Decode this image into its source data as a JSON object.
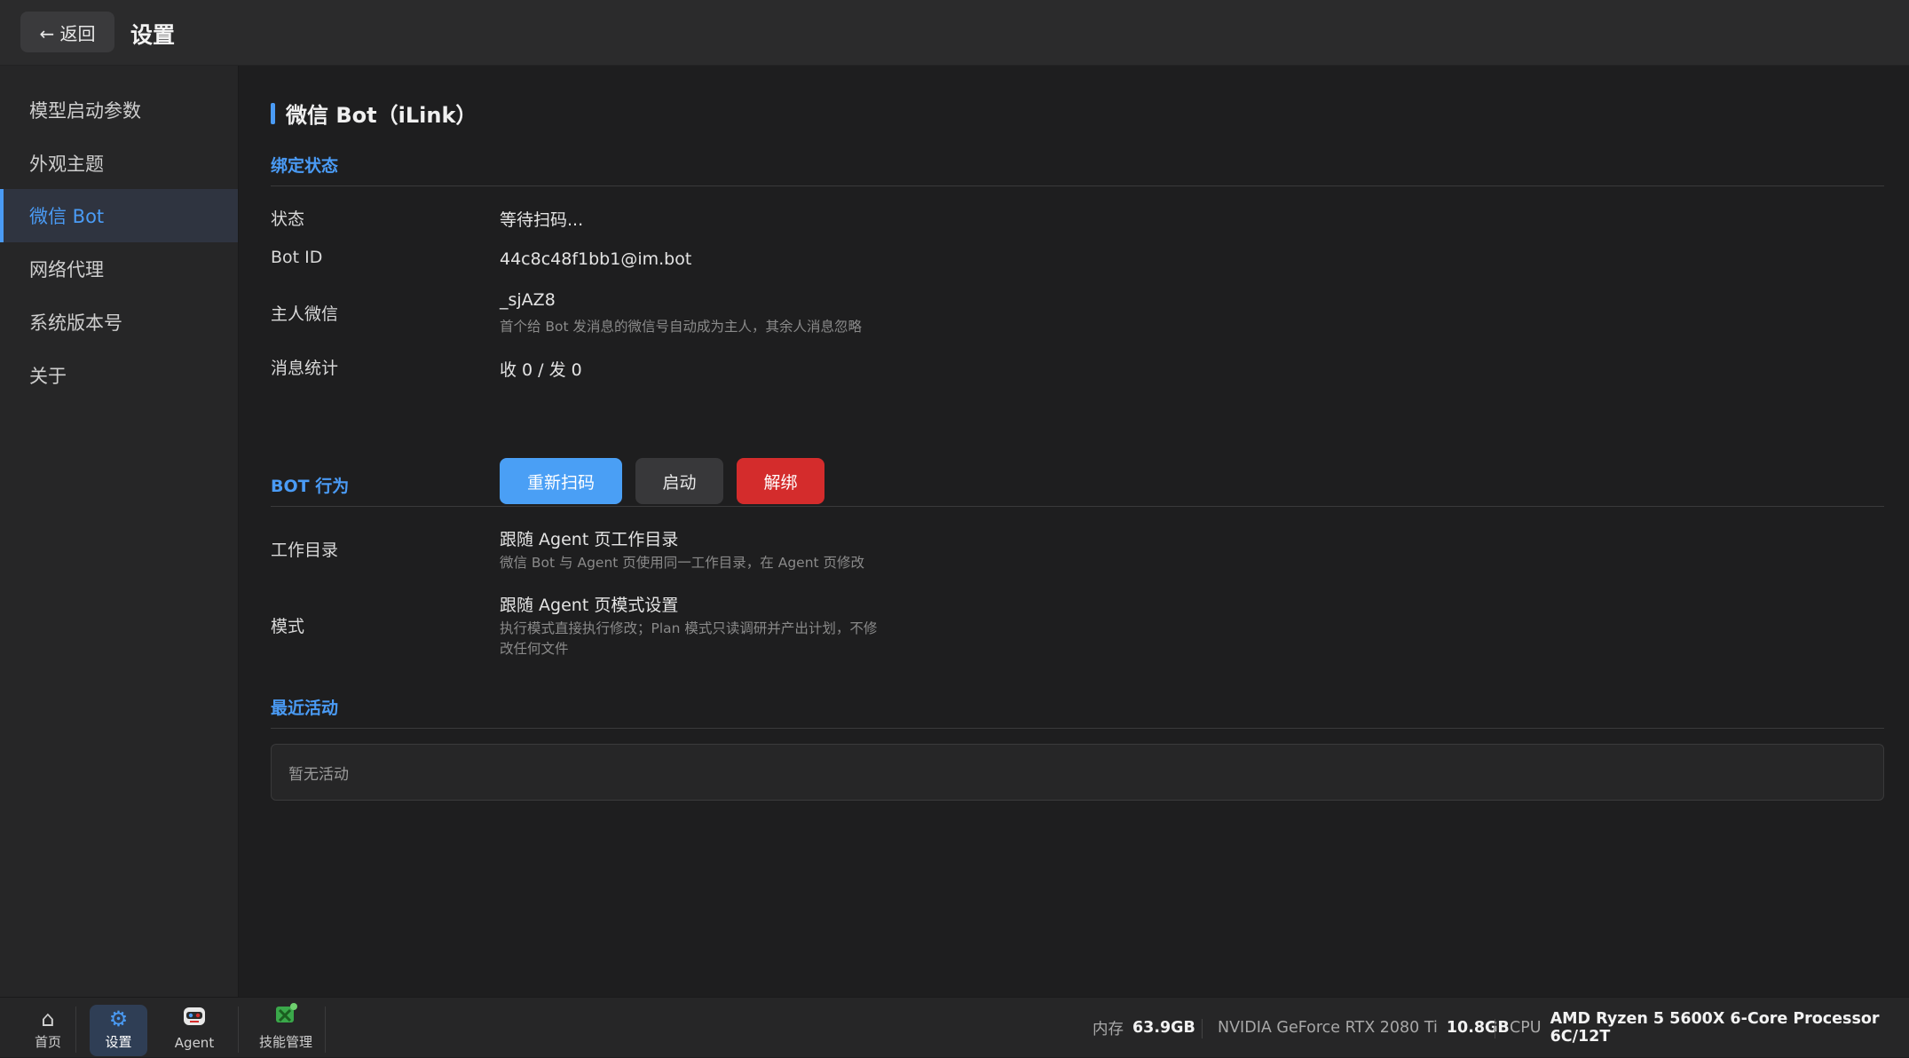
{
  "header": {
    "back_label": "← 返回",
    "title": "设置"
  },
  "sidebar": {
    "items": [
      {
        "label": "模型启动参数"
      },
      {
        "label": "外观主题"
      },
      {
        "label": "微信 Bot"
      },
      {
        "label": "网络代理"
      },
      {
        "label": "系统版本号"
      },
      {
        "label": "关于"
      }
    ],
    "active_index": 2
  },
  "main": {
    "title": "微信 Bot（iLink）",
    "binding": {
      "group_title": "绑定状态",
      "status_label": "状态",
      "status_value": "等待扫码...",
      "botid_label": "Bot ID",
      "botid_value": "44c8c48f1bb1@im.bot",
      "owner_label": "主人微信",
      "owner_value": "_sjAZ8",
      "owner_hint": "首个给 Bot 发消息的微信号自动成为主人，其余人消息忽略",
      "stats_label": "消息统计",
      "stats_value": "收 0 / 发 0",
      "rescan_label": "重新扫码",
      "start_label": "启动",
      "unbind_label": "解绑"
    },
    "behavior": {
      "group_title": "BOT 行为",
      "workdir_label": "工作目录",
      "workdir_value": "跟随 Agent 页工作目录",
      "workdir_hint": "微信 Bot 与 Agent 页使用同一工作目录，在 Agent 页修改",
      "mode_label": "模式",
      "mode_value": "跟随 Agent 页模式设置",
      "mode_hint_line1": "执行模式直接执行修改；Plan 模式只读调研并产出计划，不修",
      "mode_hint_line2": "改任何文件"
    },
    "activity": {
      "group_title": "最近活动",
      "empty_text": "暂无活动"
    }
  },
  "dock": {
    "items": [
      {
        "label": "首页",
        "icon": "home-icon"
      },
      {
        "label": "设置",
        "icon": "gear-icon"
      },
      {
        "label": "Agent",
        "icon": "robot-icon"
      },
      {
        "label": "技能管理",
        "icon": "puzzle-icon"
      }
    ],
    "active_index": 1
  },
  "status": {
    "mem_label": "内存",
    "mem_value": "63.9GB",
    "gpu_label": "NVIDIA GeForce RTX 2080 Ti",
    "gpu_value": "10.8GB",
    "cpu_label": "CPU",
    "cpu_value": "AMD Ryzen 5 5600X 6-Core Processor 6C/12T"
  },
  "colors": {
    "accent": "#4a9bf5",
    "danger": "#d42c2c",
    "bg": "#1e1e1f"
  }
}
